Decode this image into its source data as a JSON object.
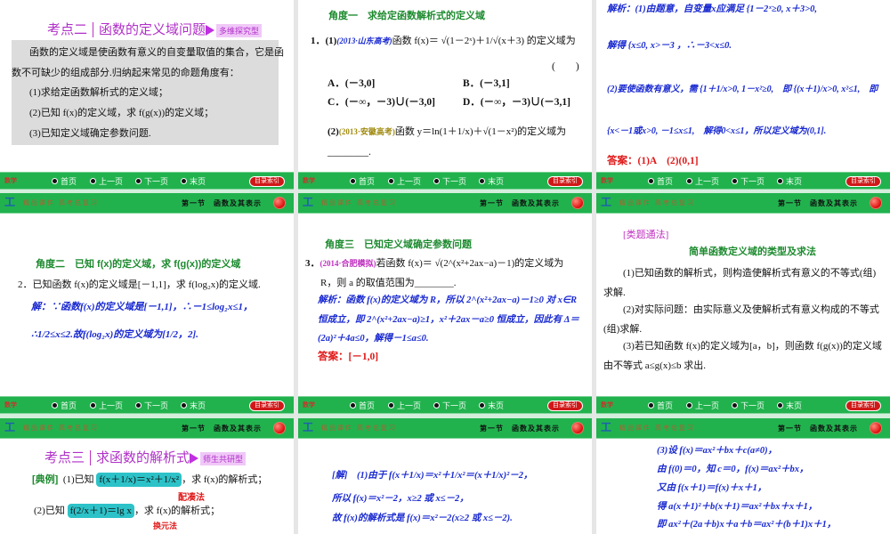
{
  "nav": {
    "subject": "数学",
    "first": "首页",
    "prev": "上一页",
    "next": "下一页",
    "last": "末页",
    "index": "目录索引"
  },
  "header": {
    "tagline": "精品课件 高考总复习",
    "section": "第一节　函数及其表示"
  },
  "slides": {
    "s1": {
      "label": "考点二",
      "title": "函数的定义域问题",
      "tag": "多维探究型",
      "p1": "函数的定义域是使函数有意义的自变量取值的集合，它是函",
      "p2": "数不可缺少的组成部分.归纳起来常见的命题角度有：",
      "i1": "(1)求给定函数解析式的定义域；",
      "i2": "(2)已知 f(x)的定义域，求 f(g(x))的定义域；",
      "i3": "(3)已知定义域确定参数问题."
    },
    "s2": {
      "heading": "角度一　求给定函数解析式的定义域",
      "q_num": "1．(1)",
      "q_src": "(2013·山东高考)",
      "q_text": "函数 f(x)＝ √(1－2ˣ)＋1/√(x＋3) 的定义域为",
      "paren": "(　　)",
      "a": "A．(－3,0]",
      "b": "B．(－3,1]",
      "c": "C．(－∞，－3)∪(－3,0]",
      "d": "D．(－∞，－3)∪(－3,1]",
      "q2_num": "(2)",
      "q2_src": "(2013·安徽高考)",
      "q2_text": "函数 y＝ln(1＋1/x)＋√(1－x²)的定义域为",
      "blank": "________."
    },
    "s3": {
      "l1": "解析：(1)由题意，自变量x应满足 {1－2ˣ≥0, x＋3>0,",
      "l2": "解得 {x≤0, x>－3 ，∴－3<x≤0.",
      "l3": "(2)要使函数有意义，需 {1＋1/x>0, 1－x²≥0,　即 {(x＋1)/x>0, x²≤1,　即",
      "l4": "{x<－1或x>0, －1≤x≤1,　解得0<x≤1，所以定义域为(0,1].",
      "answer": "答案：(1)A　(2)(0,1]"
    },
    "s4": {
      "heading": "角度二　已知 f(x)的定义域，求 f(g(x))的定义域",
      "q": "2．已知函数 f(x)的定义域是[－1,1]，求 f(log₂x)的定义域.",
      "s1": "解：∵函数f(x)的定义域是[－1,1]，∴－1≤log₂x≤1，",
      "s2": "∴1/2≤x≤2.故f(log₂x)的定义域为[1/2，2]."
    },
    "s5": {
      "heading": "角度三　已知定义域确定参数问题",
      "q_num": "3．",
      "q_src": "(2014·合肥模拟)",
      "q_text": "若函数 f(x)＝ √(2^(x²+2ax−a)－1)的定义域为",
      "q2": "R，则 a 的取值范围为________.",
      "l1": "解析：函数 f(x)的定义域为 R，所以 2^(x²+2ax−a)－1≥0 对 x∈R",
      "l2": "恒成立，即 2^(x²+2ax−a)≥1，x²＋2ax－a≥0 恒成立，因此有 Δ＝",
      "l3": "(2a)²＋4a≤0，解得－1≤a≤0.",
      "answer": "答案：[－1,0]"
    },
    "s6": {
      "tag": "[类题通法]",
      "heading": "简单函数定义域的类型及求法",
      "p1a": "(1)已知函数的解析式，则构造使解析式有意义的不等式(组)",
      "p1b": "求解.",
      "p2a": "(2)对实际问题：由实际意义及使解析式有意义构成的不等式",
      "p2b": "(组)求解.",
      "p3a": "(3)若已知函数 f(x)的定义域为[a，b]，则函数 f(g(x))的定义域",
      "p3b": "由不等式 a≤g(x)≤b 求出."
    },
    "s7": {
      "label": "考点三",
      "title": "求函数的解析式",
      "tag": "师生共研型",
      "ex": "[典例]",
      "e1a": "(1)已知",
      "e1f": "f(x＋1/x)＝x²＋1/x²",
      "e1b": "，求 f(x)的解析式；",
      "m1": "配凑法",
      "e2a": "(2)已知",
      "e2f": "f(2/x＋1)＝lg x",
      "e2b": "，求 f(x)的解析式；",
      "m2": "换元法"
    },
    "s8": {
      "l1": "[解]　(1)由于 f(x＋1/x)＝x²＋1/x²＝(x＋1/x)²－2，",
      "l2": "所以 f(x)＝x²－2，x≥2 或 x≤－2，",
      "l3": "故 f(x)的解析式是 f(x)＝x²－2(x≥2 或 x≤－2)."
    },
    "s9": {
      "l1": "(3)设 f(x)＝ax²＋bx＋c(a≠0)，",
      "l2": "由 f(0)＝0，知 c＝0，f(x)＝ax²＋bx，",
      "l3": "又由 f(x＋1)＝f(x)＋x＋1，",
      "l4": "得 a(x＋1)²＋b(x＋1)＝ax²＋bx＋x＋1，",
      "l5": "即 ax²＋(2a＋b)x＋a＋b＝ax²＋(b＋1)x＋1，"
    }
  }
}
